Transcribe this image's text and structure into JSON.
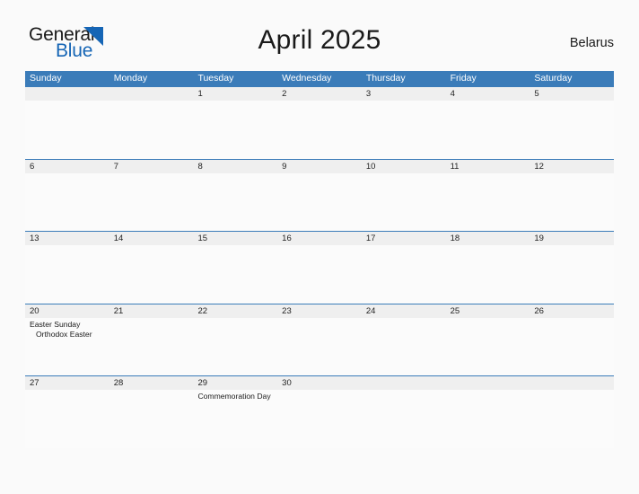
{
  "logo": {
    "line1": "General",
    "line2": "Blue",
    "triangle_icon": "blue-triangle-flag",
    "color_dark": "#1a1a1a",
    "color_blue": "#1565b5"
  },
  "header": {
    "title": "April 2025",
    "country": "Belarus"
  },
  "theme": {
    "accent_blue": "#3b7cb9",
    "date_band": "#efefef",
    "cell_bg": "#fbfbfb",
    "page_bg": "#fafafa"
  },
  "calendar": {
    "month": "April",
    "year": "2025",
    "weekdays": [
      "Sunday",
      "Monday",
      "Tuesday",
      "Wednesday",
      "Thursday",
      "Friday",
      "Saturday"
    ],
    "weeks": [
      [
        {
          "date": "",
          "events": []
        },
        {
          "date": "",
          "events": []
        },
        {
          "date": "1",
          "events": []
        },
        {
          "date": "2",
          "events": []
        },
        {
          "date": "3",
          "events": []
        },
        {
          "date": "4",
          "events": []
        },
        {
          "date": "5",
          "events": []
        }
      ],
      [
        {
          "date": "6",
          "events": []
        },
        {
          "date": "7",
          "events": []
        },
        {
          "date": "8",
          "events": []
        },
        {
          "date": "9",
          "events": []
        },
        {
          "date": "10",
          "events": []
        },
        {
          "date": "11",
          "events": []
        },
        {
          "date": "12",
          "events": []
        }
      ],
      [
        {
          "date": "13",
          "events": []
        },
        {
          "date": "14",
          "events": []
        },
        {
          "date": "15",
          "events": []
        },
        {
          "date": "16",
          "events": []
        },
        {
          "date": "17",
          "events": []
        },
        {
          "date": "18",
          "events": []
        },
        {
          "date": "19",
          "events": []
        }
      ],
      [
        {
          "date": "20",
          "events": [
            {
              "label": "Easter Sunday",
              "indent": false
            },
            {
              "label": "Orthodox Easter",
              "indent": true
            }
          ]
        },
        {
          "date": "21",
          "events": []
        },
        {
          "date": "22",
          "events": []
        },
        {
          "date": "23",
          "events": []
        },
        {
          "date": "24",
          "events": []
        },
        {
          "date": "25",
          "events": []
        },
        {
          "date": "26",
          "events": []
        }
      ],
      [
        {
          "date": "27",
          "events": []
        },
        {
          "date": "28",
          "events": []
        },
        {
          "date": "29",
          "events": [
            {
              "label": "Commemoration Day",
              "indent": false
            }
          ]
        },
        {
          "date": "30",
          "events": []
        },
        {
          "date": "",
          "events": []
        },
        {
          "date": "",
          "events": []
        },
        {
          "date": "",
          "events": []
        }
      ]
    ]
  }
}
